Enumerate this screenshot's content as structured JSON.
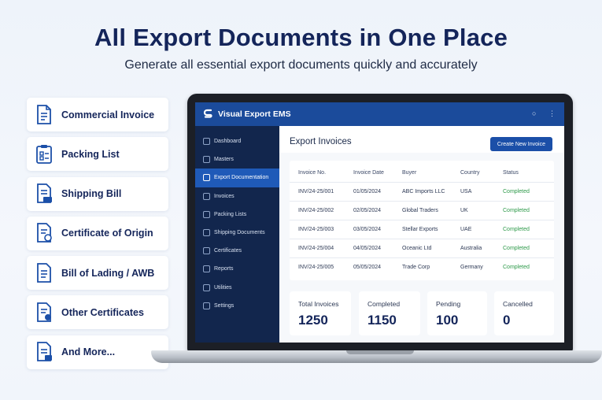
{
  "hero": {
    "title": "All Export Documents in One Place",
    "subtitle": "Generate all essential export documents quickly and accurately"
  },
  "features": [
    {
      "label": "Commercial Invoice",
      "icon": "document-icon"
    },
    {
      "label": "Packing List",
      "icon": "clipboard-icon"
    },
    {
      "label": "Shipping Bill",
      "icon": "document-stamp-icon"
    },
    {
      "label": "Certificate of Origin",
      "icon": "certificate-icon"
    },
    {
      "label": "Bill of Lading / AWB",
      "icon": "document-icon"
    },
    {
      "label": "Other Certificates",
      "icon": "certificate-icon"
    },
    {
      "label": "And More...",
      "icon": "document-icon"
    }
  ],
  "app": {
    "title": "Visual Export EMS",
    "brand_color": "#1b4b9b",
    "sidebar_color": "#12264d",
    "active_color": "#1f5ab8"
  },
  "sidebar": {
    "items": [
      {
        "label": "Dashboard",
        "active": false
      },
      {
        "label": "Masters",
        "active": false
      },
      {
        "label": "Export Documentation",
        "active": true
      },
      {
        "label": "Invoices",
        "active": false
      },
      {
        "label": "Packing Lists",
        "active": false
      },
      {
        "label": "Shipping Documents",
        "active": false
      },
      {
        "label": "Certificates",
        "active": false
      },
      {
        "label": "Reports",
        "active": false
      },
      {
        "label": "Utilities",
        "active": false
      },
      {
        "label": "Settings",
        "active": false
      }
    ]
  },
  "main": {
    "heading": "Export Invoices",
    "create_button": "Create New Invoice",
    "table": {
      "headers": [
        "Invoice No.",
        "Invoice Date",
        "Buyer",
        "Country",
        "Status"
      ],
      "rows": [
        [
          "INV/24-25/001",
          "01/05/2024",
          "ABC Imports LLC",
          "USA",
          "Completed"
        ],
        [
          "INV/24-25/002",
          "02/05/2024",
          "Global Traders",
          "UK",
          "Completed"
        ],
        [
          "INV/24-25/003",
          "03/05/2024",
          "Stellar Exports",
          "UAE",
          "Completed"
        ],
        [
          "INV/24-25/004",
          "04/05/2024",
          "Oceanic Ltd",
          "Australia",
          "Completed"
        ],
        [
          "INV/24-25/005",
          "05/05/2024",
          "Trade Corp",
          "Germany",
          "Completed"
        ]
      ]
    },
    "stats": [
      {
        "label": "Total Invoices",
        "value": "1250"
      },
      {
        "label": "Completed",
        "value": "1150"
      },
      {
        "label": "Pending",
        "value": "100"
      },
      {
        "label": "Cancelled",
        "value": "0"
      }
    ]
  }
}
